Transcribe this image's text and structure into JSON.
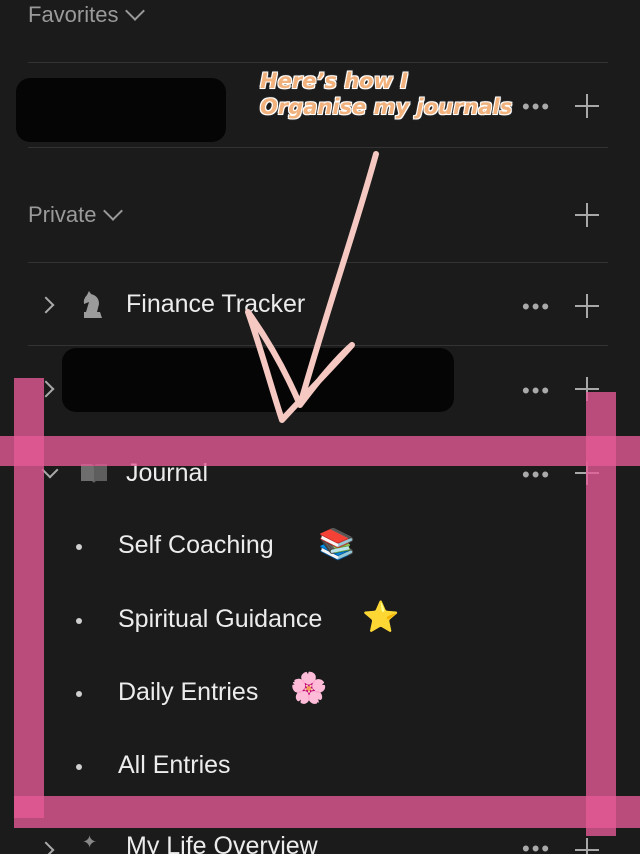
{
  "favorites": {
    "label": "Favorites"
  },
  "annotation": {
    "line1": "Here’s how I",
    "line2": "Organise my journals"
  },
  "private": {
    "label": "Private"
  },
  "items": [
    {
      "label": "Finance Tracker",
      "icon": "chess-knight-icon"
    },
    {
      "label": "Journal",
      "icon": "book-icon"
    },
    {
      "label": "My Life Overview",
      "icon": "sparkles-icon"
    }
  ],
  "journal_children": [
    {
      "label": "Self Coaching",
      "emoji": "📚"
    },
    {
      "label": "Spiritual Guidance",
      "emoji": "⭐"
    },
    {
      "label": "Daily Entries",
      "emoji": "🌸"
    },
    {
      "label": "All Entries",
      "emoji": ""
    }
  ],
  "more_symbol": "•••",
  "highlight_color": "#e65a96",
  "annotation_color": "#f2b27e"
}
